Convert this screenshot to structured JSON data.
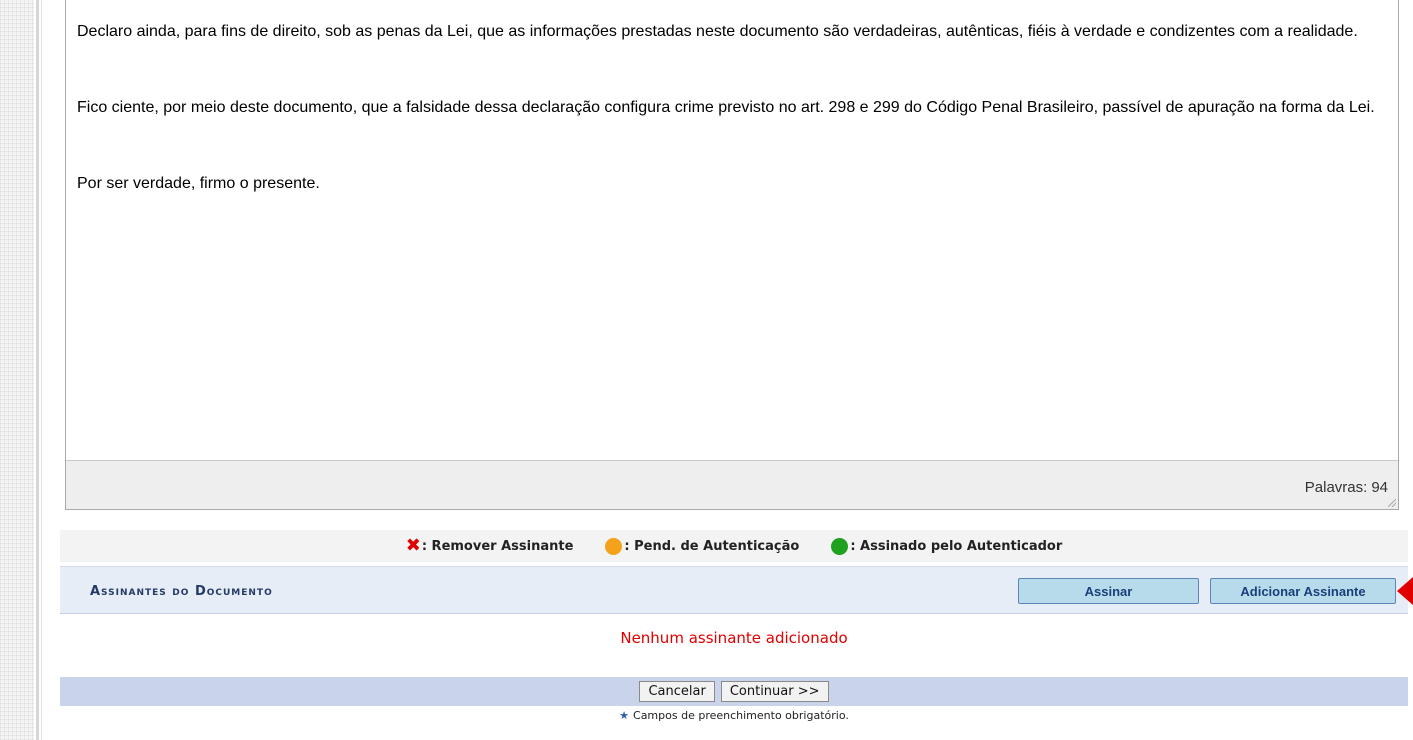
{
  "document": {
    "paragraphs": [
      "Declaro ainda, para fins de direito, sob as penas da Lei, que as informações prestadas neste documento são verdadeiras, autênticas, fiéis à verdade e condizentes com a realidade.",
      "Fico ciente, por meio deste documento, que a falsidade dessa declaração configura crime previsto no art. 298 e 299 do Código Penal Brasileiro, passível de apuração na forma da Lei.",
      "Por ser verdade, firmo o presente."
    ],
    "word_count_label": "Palavras:",
    "word_count": "94"
  },
  "legend": {
    "remove": ": Remover Assinante",
    "pending": ": Pend. de Autenticação",
    "signed": ": Assinado pelo Autenticador",
    "remove_icon": "red-x-icon",
    "pending_icon": "orange-dot-icon",
    "signed_icon": "green-dot-icon",
    "colors": {
      "remove": "#e00000",
      "pending": "#f4a21c",
      "signed": "#1ea11e"
    }
  },
  "signers": {
    "title": "Assinantes do Documento",
    "sign_button": "Assinar",
    "add_signer_button": "Adicionar Assinante",
    "empty_message": "Nenhum assinante adicionado"
  },
  "actions": {
    "cancel": "Cancelar",
    "continue": "Continuar >>"
  },
  "footer": {
    "required_note": "Campos de preenchimento obrigatório."
  }
}
